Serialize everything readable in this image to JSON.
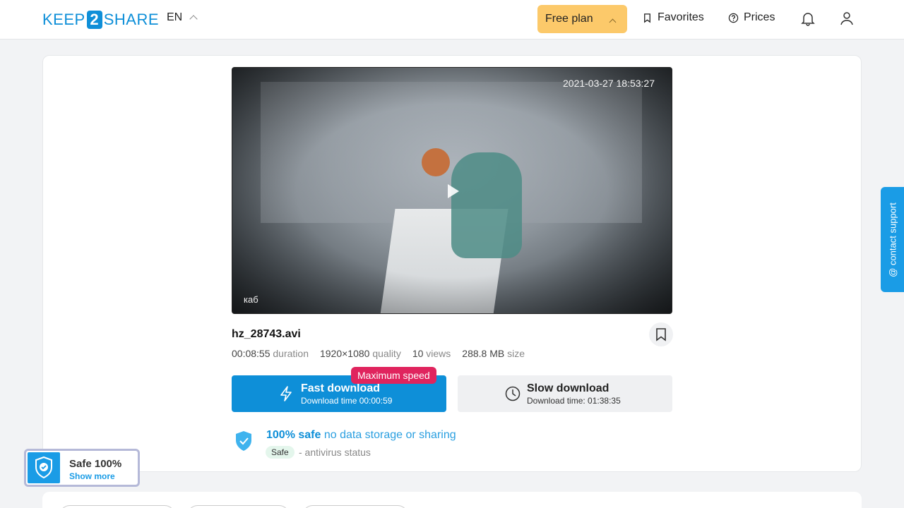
{
  "header": {
    "logo_left": "KEEP",
    "logo_mid": "2",
    "logo_right": "SHARE",
    "lang": "EN",
    "plan": "Free plan",
    "favorites": "Favorites",
    "prices": "Prices"
  },
  "video": {
    "timestamp": "2021-03-27 18:53:27",
    "camera_label": "каб"
  },
  "file": {
    "name": "hz_28743.avi",
    "duration": "00:08:55",
    "duration_label": "duration",
    "quality": "1920×1080",
    "quality_label": "quality",
    "views": "10",
    "views_label": "views",
    "size": "288.8 MB",
    "size_label": "size"
  },
  "downloads": {
    "badge": "Maximum speed",
    "fast_title": "Fast download",
    "fast_sub": "Download time 00:00:59",
    "slow_title": "Slow download",
    "slow_sub": "Download time: 01:38:35"
  },
  "safety": {
    "strong": "100% safe",
    "rest": "no data storage or sharing",
    "pill": "Safe",
    "note": "- antivirus status"
  },
  "support": {
    "label": "@ contact support"
  },
  "widget": {
    "title": "Safe 100%",
    "more": "Show more"
  },
  "colors": {
    "accent": "#0e8fd8",
    "plan": "#fcc96a",
    "badge": "#e0245e"
  }
}
